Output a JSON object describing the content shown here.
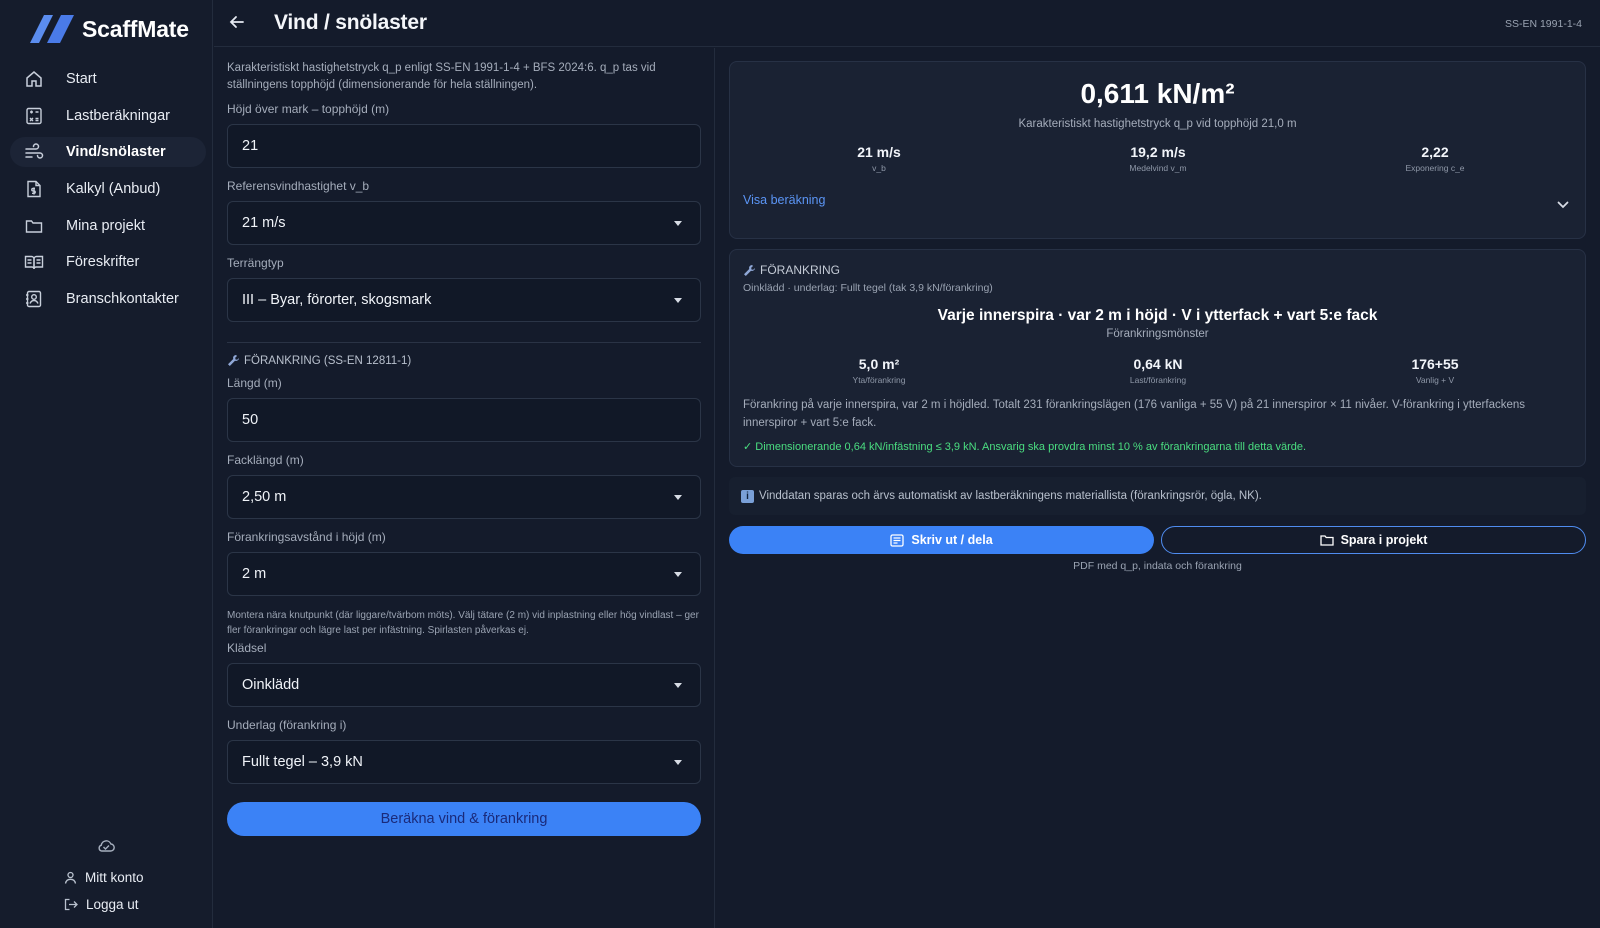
{
  "app": {
    "name": "ScaffMate"
  },
  "header": {
    "title": "Vind / snölaster",
    "standard": "SS-EN 1991-1-4"
  },
  "sidebar": {
    "items": [
      {
        "label": "Start",
        "icon": "home-icon"
      },
      {
        "label": "Lastberäkningar",
        "icon": "calculator-icon"
      },
      {
        "label": "Vind/snölaster",
        "icon": "wind-icon"
      },
      {
        "label": "Kalkyl (Anbud)",
        "icon": "invoice-icon"
      },
      {
        "label": "Mina projekt",
        "icon": "folder-icon"
      },
      {
        "label": "Föreskrifter",
        "icon": "book-icon"
      },
      {
        "label": "Branschkontakter",
        "icon": "contacts-icon"
      }
    ],
    "account": "Mitt konto",
    "logout": "Logga ut"
  },
  "form": {
    "intro": "Karakteristiskt hastighetstryck q_p enligt SS-EN 1991-1-4 + BFS 2024:6. q_p tas vid ställningens topphöjd (dimensionerande för hela ställningen).",
    "height_label": "Höjd över mark – topphöjd (m)",
    "height_value": "21",
    "vb_label": "Referensvindhastighet v_b",
    "vb_value": "21 m/s",
    "terrain_label": "Terrängtyp",
    "terrain_value": "III – Byar, förorter, skogsmark",
    "anchor_section": "FÖRANKRING (SS-EN 12811-1)",
    "length_label": "Längd (m)",
    "length_value": "50",
    "bay_label": "Facklängd (m)",
    "bay_value": "2,50 m",
    "spacing_label": "Förankringsavstånd i höjd (m)",
    "spacing_value": "2 m",
    "hint": "Montera nära knutpunkt (där liggare/tvärbom möts). Välj tätare (2 m) vid inplastning eller hög vindlast – ger fler förankringar och lägre last per infästning. Spirlasten påverkas ej.",
    "cladding_label": "Klädsel",
    "cladding_value": "Oinklädd",
    "substrate_label": "Underlag (förankring i)",
    "substrate_value": "Fullt tegel – 3,9 kN",
    "calc_button": "Beräkna vind & förankring"
  },
  "result": {
    "qp": "0,611 kN/m²",
    "qp_sub": "Karakteristiskt hastighetstryck q_p vid topphöjd 21,0 m",
    "stats": [
      {
        "value": "21 m/s",
        "label": "v_b"
      },
      {
        "value": "19,2 m/s",
        "label": "Medelvind v_m"
      },
      {
        "value": "2,22",
        "label": "Exponering c_e"
      }
    ],
    "show_calc": "Visa beräkning"
  },
  "anchoring": {
    "heading": "FÖRANKRING",
    "sub": "Oinklädd · underlag: Fullt tegel (tak 3,9 kN/förankring)",
    "pattern": "Varje innerspira · var 2 m i höjd · V i ytterfack + vart 5:e fack",
    "pattern_label": "Förankringsmönster",
    "stats": [
      {
        "value": "5,0 m²",
        "label": "Yta/förankring"
      },
      {
        "value": "0,64 kN",
        "label": "Last/förankring"
      },
      {
        "value": "176+55",
        "label": "Vanlig + V"
      }
    ],
    "description": "Förankring på varje innerspira, var 2 m i höjdled. Totalt 231 förankringslägen (176 vanliga + 55 V) på 21 innerspiror × 11 nivåer. V-förankring i ytterfackens innerspiror + vart 5:e fack.",
    "check": "✓ Dimensionerande 0,64 kN/infästning ≤ 3,9 kN. Ansvarig ska provdra minst 10 % av förankringarna till detta värde."
  },
  "info": {
    "icon": "i",
    "text": "Vinddatan sparas och ärvs automatiskt av lastberäkningens materiallista (förankringsrör, ögla, NK)."
  },
  "actions": {
    "print": "Skriv ut / dela",
    "save": "Spara i projekt",
    "note": "PDF med q_p, indata och förankring"
  }
}
